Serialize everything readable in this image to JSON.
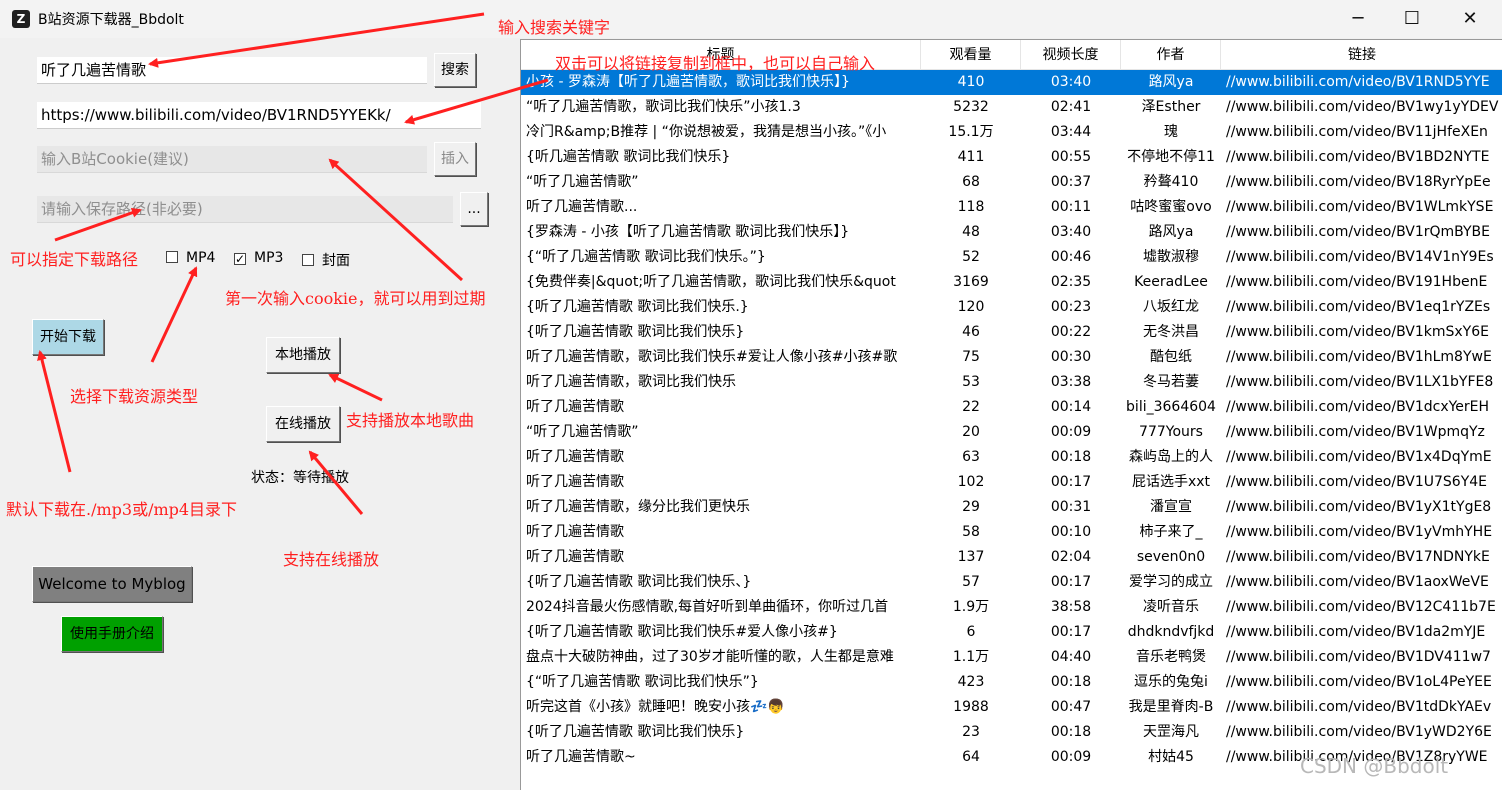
{
  "window": {
    "title": "B站资源下载器_Bbdolt",
    "app_icon": "Z",
    "minimize_icon": "─",
    "maximize_icon": "☐",
    "close_icon": "✕"
  },
  "search": {
    "value": "听了几遍苦情歌",
    "button": "搜索"
  },
  "link": {
    "value": "https://www.bilibili.com/video/BV1RND5YYEKk/"
  },
  "cookie": {
    "placeholder": "输入B站Cookie(建议)",
    "button": "插入"
  },
  "save_path": {
    "placeholder": "请输入保存路径(非必要)",
    "button": "..."
  },
  "types": {
    "mp4": {
      "label": "MP4",
      "checked": false
    },
    "mp3": {
      "label": "MP3",
      "checked": true
    },
    "cover": {
      "label": "封面",
      "checked": false
    }
  },
  "buttons": {
    "start": "开始下载",
    "local_play": "本地播放",
    "online_play": "在线播放",
    "welcome": "Welcome to Myblog",
    "manual": "使用手册介绍"
  },
  "colors": {
    "start_bg": "#add8e6",
    "welcome_bg": "#808080",
    "manual_bg": "#00a000",
    "selection": "#0078d7",
    "annotation": "#ff2020"
  },
  "status": "状态：等待播放",
  "annotations": {
    "search_kw": "输入搜索关键字",
    "double_click": "双击可以将链接复制到框中，也可以自己输入",
    "save_path": "可以指定下载路径",
    "cookie": "第一次输入cookie，就可以用到过期",
    "type": "选择下载资源类型",
    "local": "支持播放本地歌曲",
    "default_dir": "默认下载在./mp3或/mp4目录下",
    "online": "支持在线播放"
  },
  "table": {
    "headers": [
      "标题",
      "观看量",
      "视频长度",
      "作者",
      "链接"
    ],
    "rows": [
      [
        "小孩 - 罗森涛【听了几遍苦情歌，歌词比我们快乐】}",
        "410",
        "03:40",
        "路风ya",
        "//www.bilibili.com/video/BV1RND5YYE"
      ],
      [
        "“听了几遍苦情歌，歌词比我们快乐”小孩1.3",
        "5232",
        "02:41",
        "泽Esther",
        "//www.bilibili.com/video/BV1wy1yYDEV"
      ],
      [
        "冷门R&amp;B推荐 | “你说想被爱，我猜是想当小孩。”《小",
        "15.1万",
        "03:44",
        "瑰",
        "//www.bilibili.com/video/BV11jHfeXEn"
      ],
      [
        "{听几遍苦情歌 歌词比我们快乐}",
        "411",
        "00:55",
        "不停地不停11",
        "//www.bilibili.com/video/BV1BD2NYTE"
      ],
      [
        "“听了几遍苦情歌”",
        "68",
        "00:37",
        "矜聱410",
        "//www.bilibili.com/video/BV18RyrYpEe"
      ],
      [
        "听了几遍苦情歌...",
        "118",
        "00:11",
        "咕咚蜜蜜ovo",
        "//www.bilibili.com/video/BV1WLmkYSE"
      ],
      [
        "{罗森涛 - 小孩【听了几遍苦情歌 歌词比我们快乐】}",
        "48",
        "03:40",
        "路风ya",
        "//www.bilibili.com/video/BV1rQmBYBE"
      ],
      [
        "{“听了几遍苦情歌 歌词比我们快乐。”}",
        "52",
        "00:46",
        "墟散淑穆",
        "//www.bilibili.com/video/BV14V1nY9Es"
      ],
      [
        "{免费伴奏|&quot;听了几遍苦情歌，歌词比我们快乐&quot",
        "3169",
        "02:35",
        "KeeradLee",
        "//www.bilibili.com/video/BV191HbenE"
      ],
      [
        "{听了几遍苦情歌 歌词比我们快乐.}",
        "120",
        "00:23",
        "八坂红龙",
        "//www.bilibili.com/video/BV1eq1rYZEs"
      ],
      [
        "{听了几遍苦情歌 歌词比我们快乐}",
        "46",
        "00:22",
        "无冬洪昌",
        "//www.bilibili.com/video/BV1kmSxY6E"
      ],
      [
        "听了几遍苦情歌，歌词比我们快乐#爱让人像小孩#小孩#歌",
        "75",
        "00:30",
        "酷包纸",
        "//www.bilibili.com/video/BV1hLm8YwE"
      ],
      [
        "听了几遍苦情歌，歌词比我们快乐",
        "53",
        "03:38",
        "冬马若萋",
        "//www.bilibili.com/video/BV1LX1bYFE8"
      ],
      [
        "听了几遍苦情歌",
        "22",
        "00:14",
        "bili_3664604",
        "//www.bilibili.com/video/BV1dcxYerEH"
      ],
      [
        "“听了几遍苦情歌”",
        "20",
        "00:09",
        "777Yours",
        "//www.bilibili.com/video/BV1WpmqYz"
      ],
      [
        "听了几遍苦情歌",
        "63",
        "00:18",
        "森屿岛上的人",
        "//www.bilibili.com/video/BV1x4DqYmE"
      ],
      [
        "听了几遍苦情歌",
        "102",
        "00:17",
        "屁话选手xxt",
        "//www.bilibili.com/video/BV1U7S6Y4E"
      ],
      [
        "听了几遍苦情歌，缘分比我们更快乐",
        "29",
        "00:31",
        "潘宣宣",
        "//www.bilibili.com/video/BV1yX1tYgE8"
      ],
      [
        "听了几遍苦情歌",
        "58",
        "00:10",
        "柿子来了_",
        "//www.bilibili.com/video/BV1yVmhYHE"
      ],
      [
        "听了几遍苦情歌",
        "137",
        "02:04",
        "seven0n0",
        "//www.bilibili.com/video/BV17NDNYkE"
      ],
      [
        "{听了几遍苦情歌 歌词比我们快乐、}",
        "57",
        "00:17",
        "爱学习的成立",
        "//www.bilibili.com/video/BV1aoxWeVE"
      ],
      [
        "2024抖音最火伤感情歌,每首好听到单曲循环，你听过几首",
        "1.9万",
        "38:58",
        "凌听音乐",
        "//www.bilibili.com/video/BV12C411b7E"
      ],
      [
        "{听了几遍苦情歌  歌词比我们快乐#爱人像小孩#}",
        "6",
        "00:17",
        "dhdkndvfjkd",
        "//www.bilibili.com/video/BV1da2mYJE"
      ],
      [
        "盘点十大破防神曲，过了30岁才能听懂的歌，人生都是意难",
        "1.1万",
        "04:40",
        "音乐老鸭煲",
        "//www.bilibili.com/video/BV1DV411w7"
      ],
      [
        "{“听了几遍苦情歌  歌词比我们快乐”}",
        "423",
        "00:18",
        "逗乐的兔兔i",
        "//www.bilibili.com/video/BV1oL4PeYEE"
      ],
      [
        "听完这首《小孩》就睡吧！晚安小孩💤👦",
        "1988",
        "00:47",
        "我是里脊肉-B",
        "//www.bilibili.com/video/BV1tdDkYAEv"
      ],
      [
        "{听了几遍苦情歌 歌词比我们快乐}",
        "23",
        "00:18",
        "天罡海凡",
        "//www.bilibili.com/video/BV1yWD2Y6E"
      ],
      [
        "听了几遍苦情歌~",
        "64",
        "00:09",
        "村姑45",
        "//www.bilibili.com/video/BV1Z8ryYWE"
      ]
    ]
  },
  "watermark": "CSDN @Bbdolt"
}
